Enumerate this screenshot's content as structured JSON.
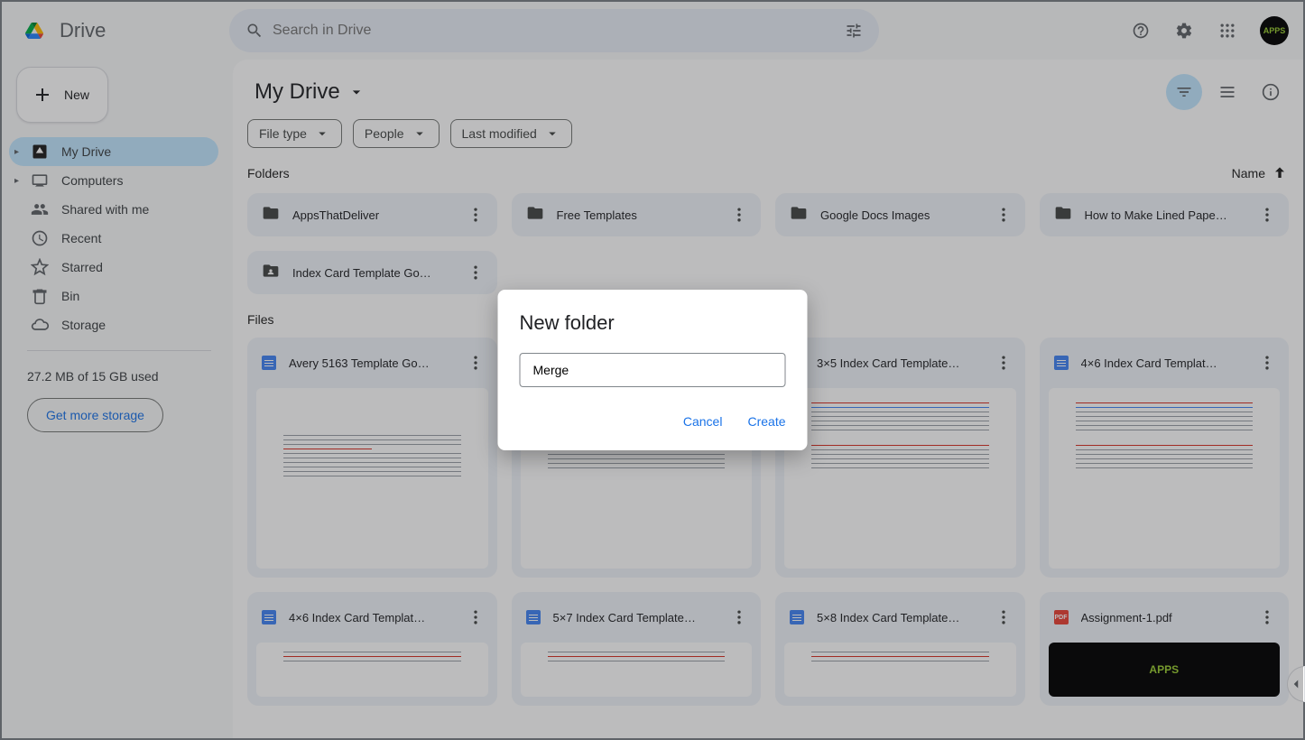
{
  "header": {
    "product_name": "Drive",
    "search_placeholder": "Search in Drive",
    "avatar_text": "APPS"
  },
  "sidebar": {
    "new_label": "New",
    "items": [
      {
        "label": "My Drive",
        "icon": "drive",
        "active": true,
        "expandable": true
      },
      {
        "label": "Computers",
        "icon": "computer",
        "active": false,
        "expandable": true
      },
      {
        "label": "Shared with me",
        "icon": "people",
        "active": false
      },
      {
        "label": "Recent",
        "icon": "clock",
        "active": false
      },
      {
        "label": "Starred",
        "icon": "star",
        "active": false
      },
      {
        "label": "Bin",
        "icon": "trash",
        "active": false
      },
      {
        "label": "Storage",
        "icon": "cloud",
        "active": false
      }
    ],
    "storage_text": "27.2 MB of 15 GB used",
    "storage_btn": "Get more storage"
  },
  "main": {
    "breadcrumb": "My Drive",
    "chips": [
      "File type",
      "People",
      "Last modified"
    ],
    "sort_label": "Name",
    "folders_label": "Folders",
    "files_label": "Files",
    "folders": [
      "AppsThatDeliver",
      "Free Templates",
      "Google Docs Images",
      "How to Make Lined Pape…",
      "Index Card Template Go…"
    ],
    "files": [
      {
        "name": "Avery 5163 Template Go…",
        "type": "doc"
      },
      {
        "name": "",
        "type": "doc"
      },
      {
        "name": "3×5 Index Card Template…",
        "type": "doc"
      },
      {
        "name": "4×6 Index Card Templat…",
        "type": "doc"
      },
      {
        "name": "4×6 Index Card Templat…",
        "type": "doc"
      },
      {
        "name": "5×7 Index Card Template…",
        "type": "doc"
      },
      {
        "name": "5×8 Index Card Template…",
        "type": "doc"
      },
      {
        "name": "Assignment-1.pdf",
        "type": "pdf"
      }
    ]
  },
  "dialog": {
    "title": "New folder",
    "input_value": "Merge",
    "cancel": "Cancel",
    "create": "Create"
  }
}
